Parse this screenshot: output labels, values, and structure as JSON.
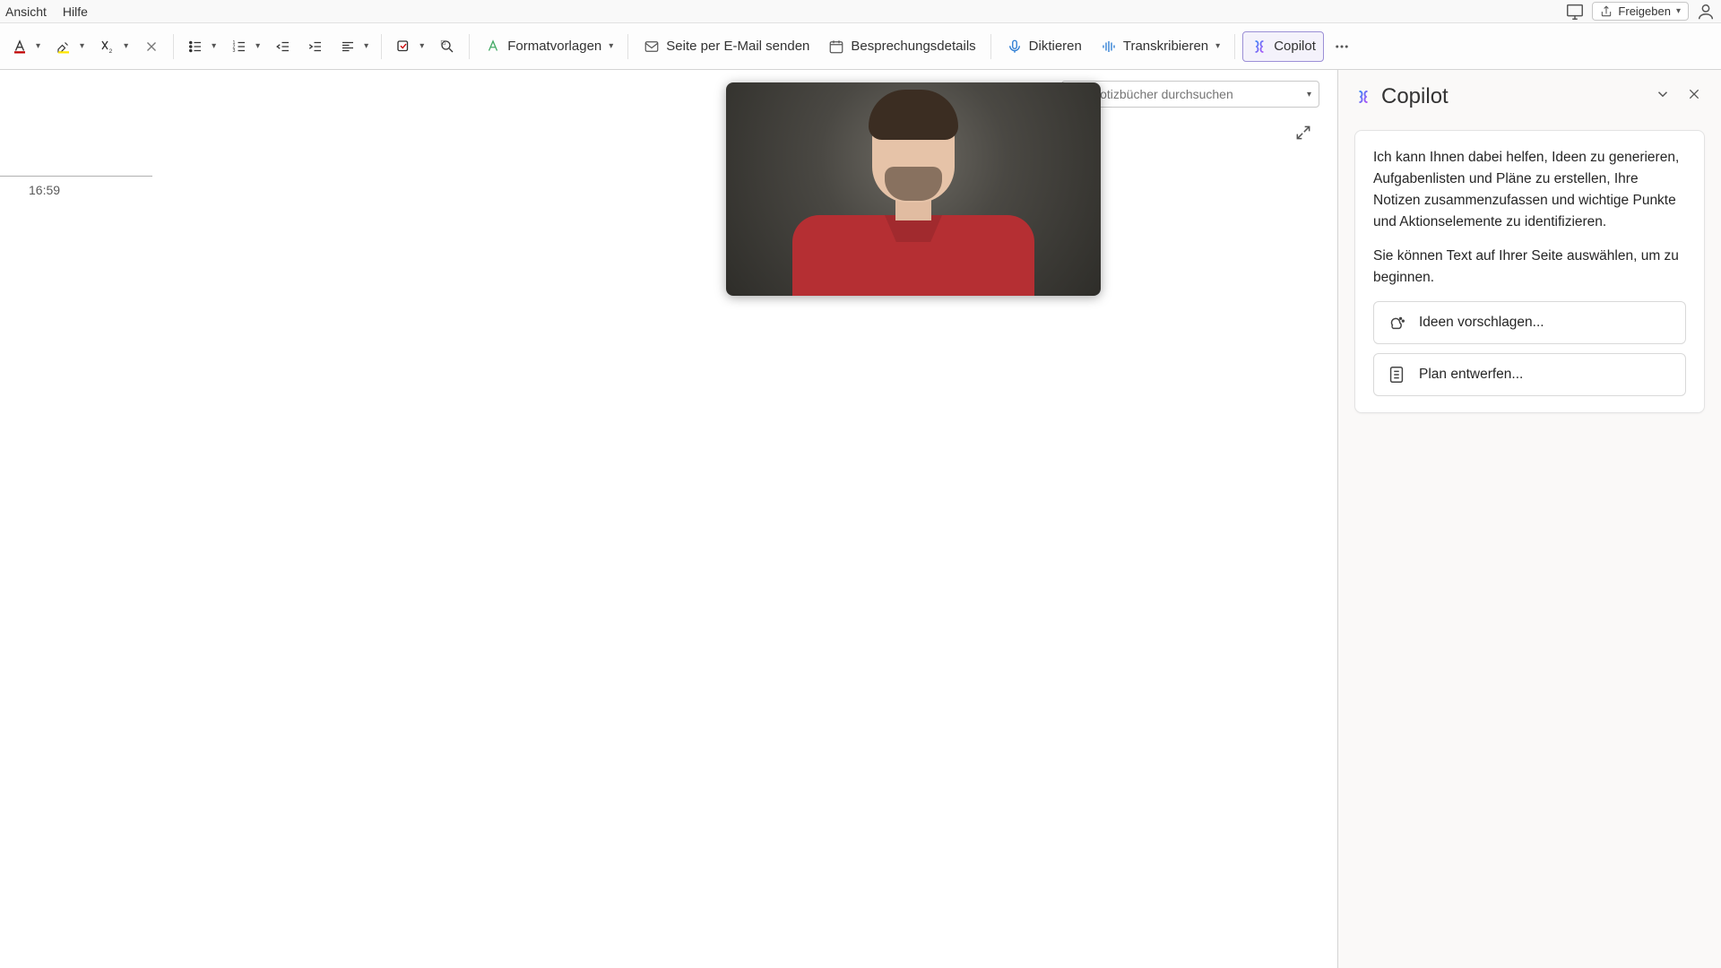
{
  "menubar": {
    "view": "Ansicht",
    "help": "Hilfe",
    "share": "Freigeben"
  },
  "ribbon": {
    "styles": "Formatvorlagen",
    "email_page": "Seite per E-Mail senden",
    "meeting_details": "Besprechungsdetails",
    "dictate": "Diktieren",
    "transcribe": "Transkribieren",
    "copilot": "Copilot"
  },
  "search": {
    "placeholder": "Notizbücher durchsuchen"
  },
  "page": {
    "timestamp": "16:59"
  },
  "copilot": {
    "title": "Copilot",
    "intro1": "Ich kann Ihnen dabei helfen, Ideen zu generieren, Aufgabenlisten und Pläne zu erstellen, Ihre Notizen zusammenzufassen und wichtige Punkte und Aktionselemente zu identifizieren.",
    "intro2": "Sie können Text auf Ihrer Seite auswählen, um zu beginnen.",
    "suggest_ideas": "Ideen vorschlagen...",
    "draft_plan": "Plan entwerfen..."
  }
}
